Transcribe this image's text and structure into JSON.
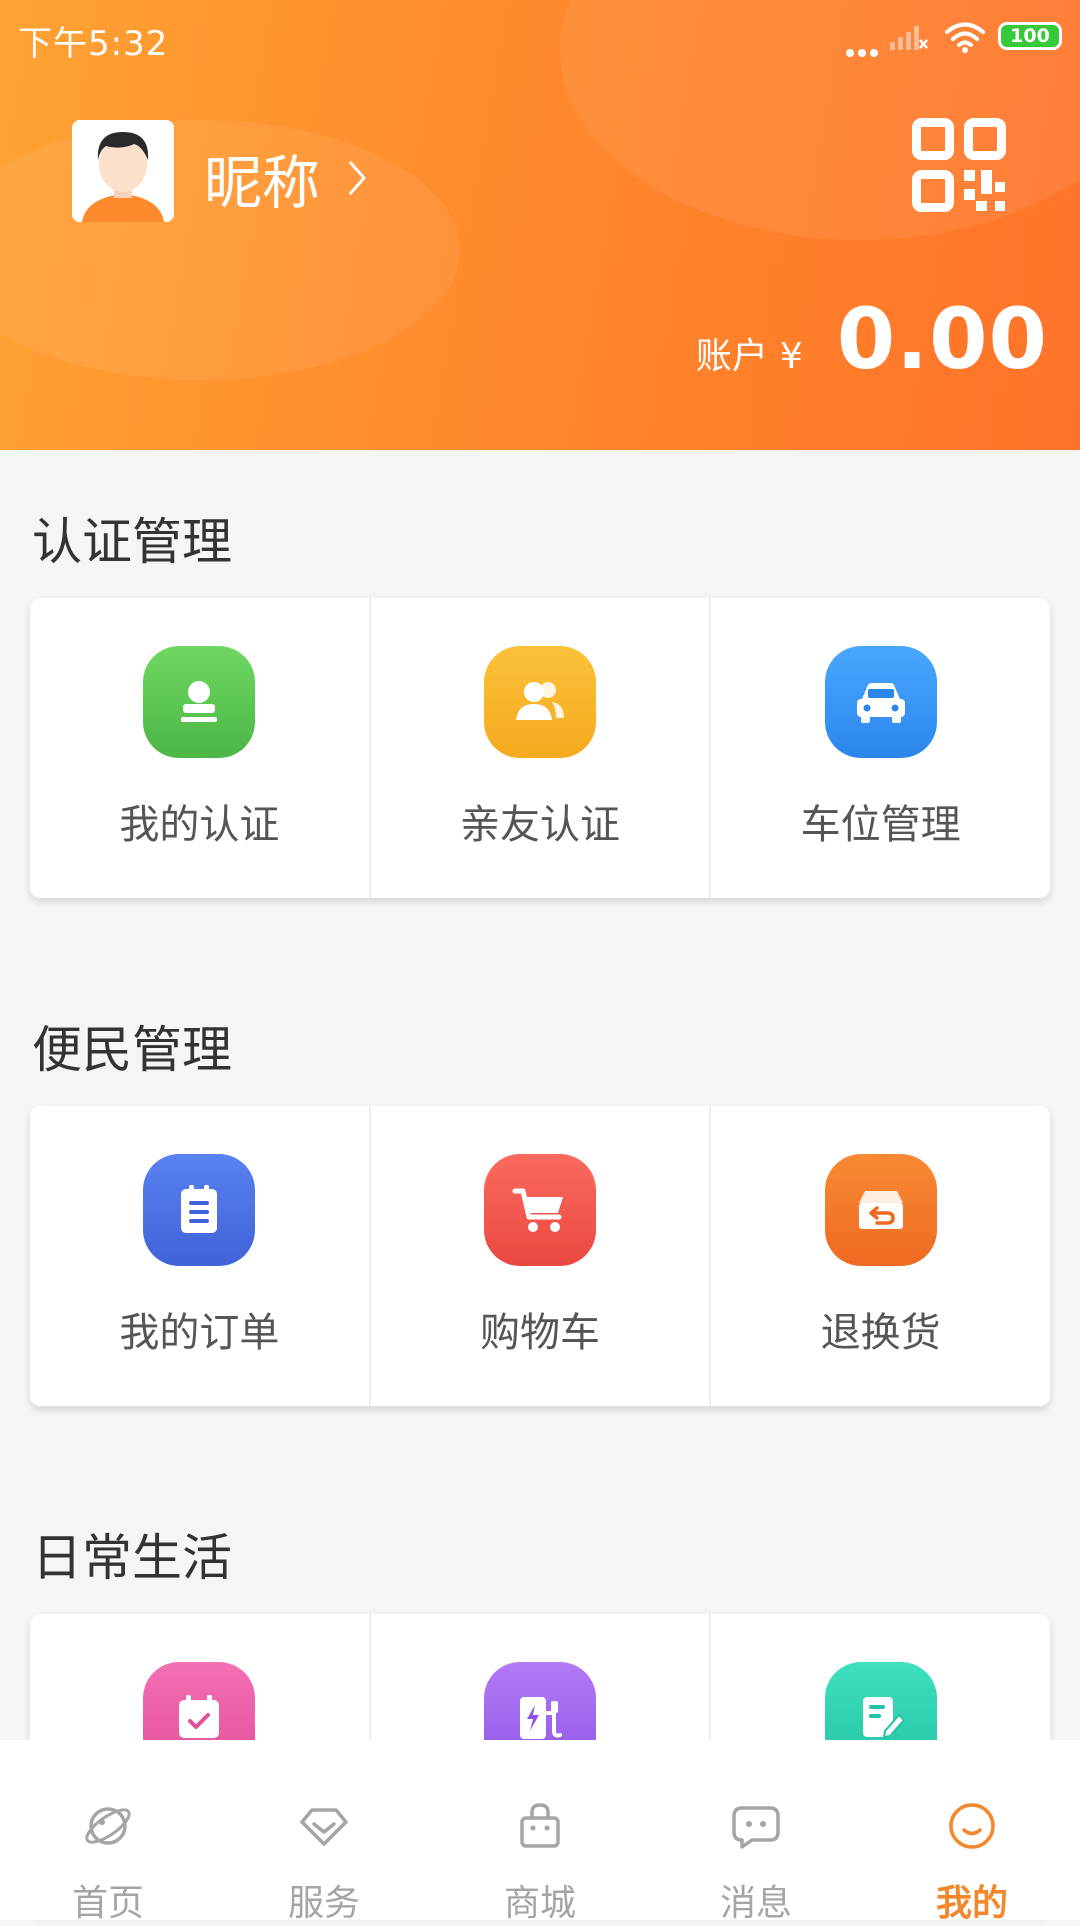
{
  "status_bar": {
    "time": "下午5:32",
    "battery": "100"
  },
  "profile": {
    "nickname": "昵称",
    "balance_label": "账户",
    "currency": "¥",
    "balance": "0.00"
  },
  "sections": [
    {
      "title": "认证管理",
      "items": [
        {
          "label": "我的认证",
          "icon": "stamp-icon",
          "color": "#5cc553"
        },
        {
          "label": "亲友认证",
          "icon": "users-icon",
          "color": "#f8b52c"
        },
        {
          "label": "车位管理",
          "icon": "car-icon",
          "color": "#3795f5"
        }
      ]
    },
    {
      "title": "便民管理",
      "items": [
        {
          "label": "我的订单",
          "icon": "order-list-icon",
          "color": "#4c72e4"
        },
        {
          "label": "购物车",
          "icon": "cart-icon",
          "color": "#f25a52"
        },
        {
          "label": "退换货",
          "icon": "return-box-icon",
          "color": "#f47a2a"
        }
      ]
    },
    {
      "title": "日常生活",
      "items": [
        {
          "label": "",
          "icon": "calendar-check-icon",
          "color": "#ee5fa6"
        },
        {
          "label": "",
          "icon": "charging-icon",
          "color": "#a06af0"
        },
        {
          "label": "",
          "icon": "edit-note-icon",
          "color": "#2fd3b3"
        }
      ]
    }
  ],
  "tabbar": {
    "tabs": [
      {
        "label": "首页",
        "icon": "planet-icon"
      },
      {
        "label": "服务",
        "icon": "diamond-icon"
      },
      {
        "label": "商城",
        "icon": "shopping-bag-icon"
      },
      {
        "label": "消息",
        "icon": "chat-bubble-icon"
      },
      {
        "label": "我的",
        "icon": "smile-icon",
        "active": true
      }
    ],
    "active_color": "#f3872b",
    "inactive_color": "#a5a5a5"
  },
  "colors": {
    "header_start": "#ffa233",
    "header_end": "#ff7329"
  }
}
